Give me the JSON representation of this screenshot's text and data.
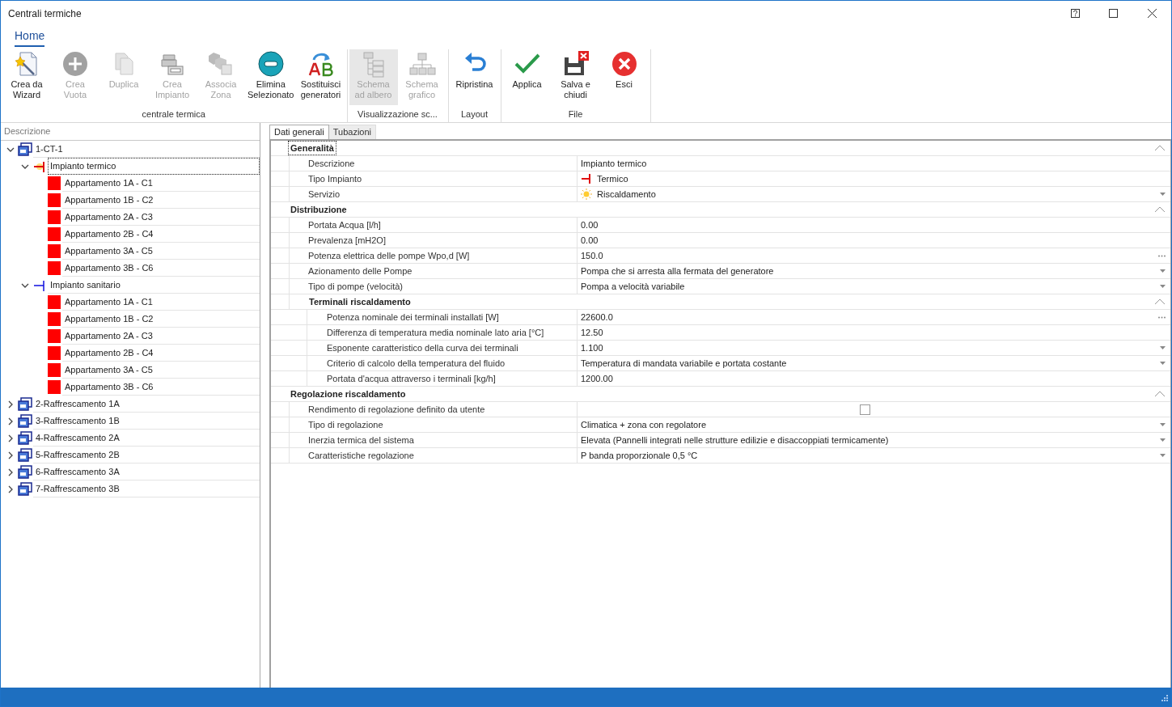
{
  "window": {
    "title": "Centrali termiche"
  },
  "ribbon": {
    "tabs": [
      {
        "label": "Home",
        "selected": true
      }
    ],
    "groups": [
      {
        "label": "centrale termica",
        "buttons": [
          {
            "kind": "wizard",
            "label": "Crea da Wizard",
            "disabled": false,
            "selected": false
          },
          {
            "kind": "plus",
            "label": "Crea Vuota",
            "disabled": true,
            "selected": false
          },
          {
            "kind": "copy",
            "label": "Duplica",
            "disabled": true,
            "selected": false
          },
          {
            "kind": "plant",
            "label": "Crea Impianto",
            "disabled": true,
            "selected": false
          },
          {
            "kind": "zone",
            "label": "Associa Zona",
            "disabled": true,
            "selected": false
          },
          {
            "kind": "minus",
            "label": "Elimina Selezionato",
            "disabled": false,
            "selected": false
          },
          {
            "kind": "swap",
            "label": "Sostituisci generatori",
            "disabled": false,
            "selected": false
          }
        ]
      },
      {
        "label": "Visualizzazione sc...",
        "buttons": [
          {
            "kind": "tree",
            "label": "Schema ad albero",
            "disabled": true,
            "selected": true
          },
          {
            "kind": "chart",
            "label": "Schema grafico",
            "disabled": true,
            "selected": false
          }
        ]
      },
      {
        "label": "Layout",
        "buttons": [
          {
            "kind": "undo",
            "label": "Ripristina",
            "disabled": false,
            "selected": false
          }
        ]
      },
      {
        "label": "File",
        "buttons": [
          {
            "kind": "check",
            "label": "Applica",
            "disabled": false,
            "selected": false
          },
          {
            "kind": "save",
            "label": "Salva e chiudi",
            "disabled": false,
            "selected": false
          },
          {
            "kind": "exit",
            "label": "Esci",
            "disabled": false,
            "selected": false
          }
        ]
      }
    ]
  },
  "tree": {
    "header": "Descrizione",
    "items": [
      {
        "kind": "building",
        "label": "1-CT-1",
        "expanded": true,
        "selected": false,
        "children": [
          {
            "kind": "heating",
            "label": "Impianto termico",
            "expanded": true,
            "selected": true,
            "children": [
              {
                "kind": "zone",
                "label": "Appartamento 1A - C1",
                "selected": false
              },
              {
                "kind": "zone",
                "label": "Appartamento 1B - C2",
                "selected": false
              },
              {
                "kind": "zone",
                "label": "Appartamento 2A - C3",
                "selected": false
              },
              {
                "kind": "zone",
                "label": "Appartamento 2B - C4",
                "selected": false
              },
              {
                "kind": "zone",
                "label": "Appartamento 3A - C5",
                "selected": false
              },
              {
                "kind": "zone",
                "label": "Appartamento 3B - C6",
                "selected": false
              }
            ]
          },
          {
            "kind": "sanitary",
            "label": "Impianto sanitario",
            "expanded": true,
            "selected": false,
            "children": [
              {
                "kind": "zone",
                "label": "Appartamento 1A - C1",
                "selected": false
              },
              {
                "kind": "zone",
                "label": "Appartamento 1B - C2",
                "selected": false
              },
              {
                "kind": "zone",
                "label": "Appartamento 2A - C3",
                "selected": false
              },
              {
                "kind": "zone",
                "label": "Appartamento 2B - C4",
                "selected": false
              },
              {
                "kind": "zone",
                "label": "Appartamento 3A - C5",
                "selected": false
              },
              {
                "kind": "zone",
                "label": "Appartamento 3B - C6",
                "selected": false
              }
            ]
          }
        ]
      },
      {
        "kind": "building",
        "label": "2-Raffrescamento 1A",
        "expanded": false,
        "selected": false
      },
      {
        "kind": "building",
        "label": "3-Raffrescamento 1B",
        "expanded": false,
        "selected": false
      },
      {
        "kind": "building",
        "label": "4-Raffrescamento 2A",
        "expanded": false,
        "selected": false
      },
      {
        "kind": "building",
        "label": "5-Raffrescamento 2B",
        "expanded": false,
        "selected": false
      },
      {
        "kind": "building",
        "label": "6-Raffrescamento 3A",
        "expanded": false,
        "selected": false
      },
      {
        "kind": "building",
        "label": "7-Raffrescamento 3B",
        "expanded": false,
        "selected": false
      }
    ]
  },
  "tabs": [
    {
      "label": "Dati generali",
      "selected": true
    },
    {
      "label": "Tubazioni",
      "selected": false
    }
  ],
  "sections": [
    {
      "title": "Generalità",
      "focused": true,
      "expanded": true,
      "rows": [
        {
          "kind": "text",
          "label": "Descrizione",
          "value": "Impianto termico"
        },
        {
          "kind": "tee",
          "label": "Tipo Impianto",
          "value": "Termico"
        },
        {
          "kind": "sun",
          "label": "Servizio",
          "value": "Riscaldamento"
        }
      ]
    },
    {
      "title": "Distribuzione",
      "focused": false,
      "expanded": true,
      "rows": [
        {
          "kind": "text",
          "label": "Portata Acqua [l/h]",
          "value": "0.00"
        },
        {
          "kind": "text",
          "label": "Prevalenza [mH2O]",
          "value": "0.00"
        },
        {
          "kind": "ellipsis",
          "label": "Potenza elettrica delle pompe Wpo,d [W]",
          "value": "150.0"
        },
        {
          "kind": "dropdown",
          "label": "Azionamento delle Pompe",
          "value": "Pompa che si arresta alla fermata del generatore"
        },
        {
          "kind": "dropdown",
          "label": "Tipo di pompe (velocità)",
          "value": "Pompa a velocità variabile"
        }
      ],
      "subsections": [
        {
          "title": "Terminali riscaldamento",
          "expanded": true,
          "rows": [
            {
              "kind": "ellipsis",
              "label": "Potenza nominale dei terminali installati [W]",
              "value": "22600.0"
            },
            {
              "kind": "text",
              "label": "Differenza di temperatura media nominale lato aria [°C]",
              "value": "12.50"
            },
            {
              "kind": "dropdown",
              "label": "Esponente caratteristico della curva dei terminali",
              "value": "1.100"
            },
            {
              "kind": "dropdown",
              "label": "Criterio di calcolo della temperatura del fluido",
              "value": "Temperatura di mandata variabile e portata costante"
            },
            {
              "kind": "text",
              "label": "Portata d'acqua attraverso i terminali [kg/h]",
              "value": "1200.00"
            }
          ]
        }
      ]
    },
    {
      "title": "Regolazione riscaldamento",
      "focused": false,
      "expanded": true,
      "rows": [
        {
          "kind": "checkbox",
          "label": "Rendimento di regolazione definito da utente",
          "checked": false
        },
        {
          "kind": "dropdown",
          "label": "Tipo di regolazione",
          "value": "Climatica + zona con regolatore"
        },
        {
          "kind": "dropdown",
          "label": "Inerzia termica del sistema",
          "value": "Elevata (Pannelli integrati nelle strutture edilizie e disaccoppiati termicamente)"
        },
        {
          "kind": "dropdown",
          "label": "Caratteristiche regolazione",
          "value": "P banda proporzionale 0,5 °C"
        }
      ]
    }
  ]
}
